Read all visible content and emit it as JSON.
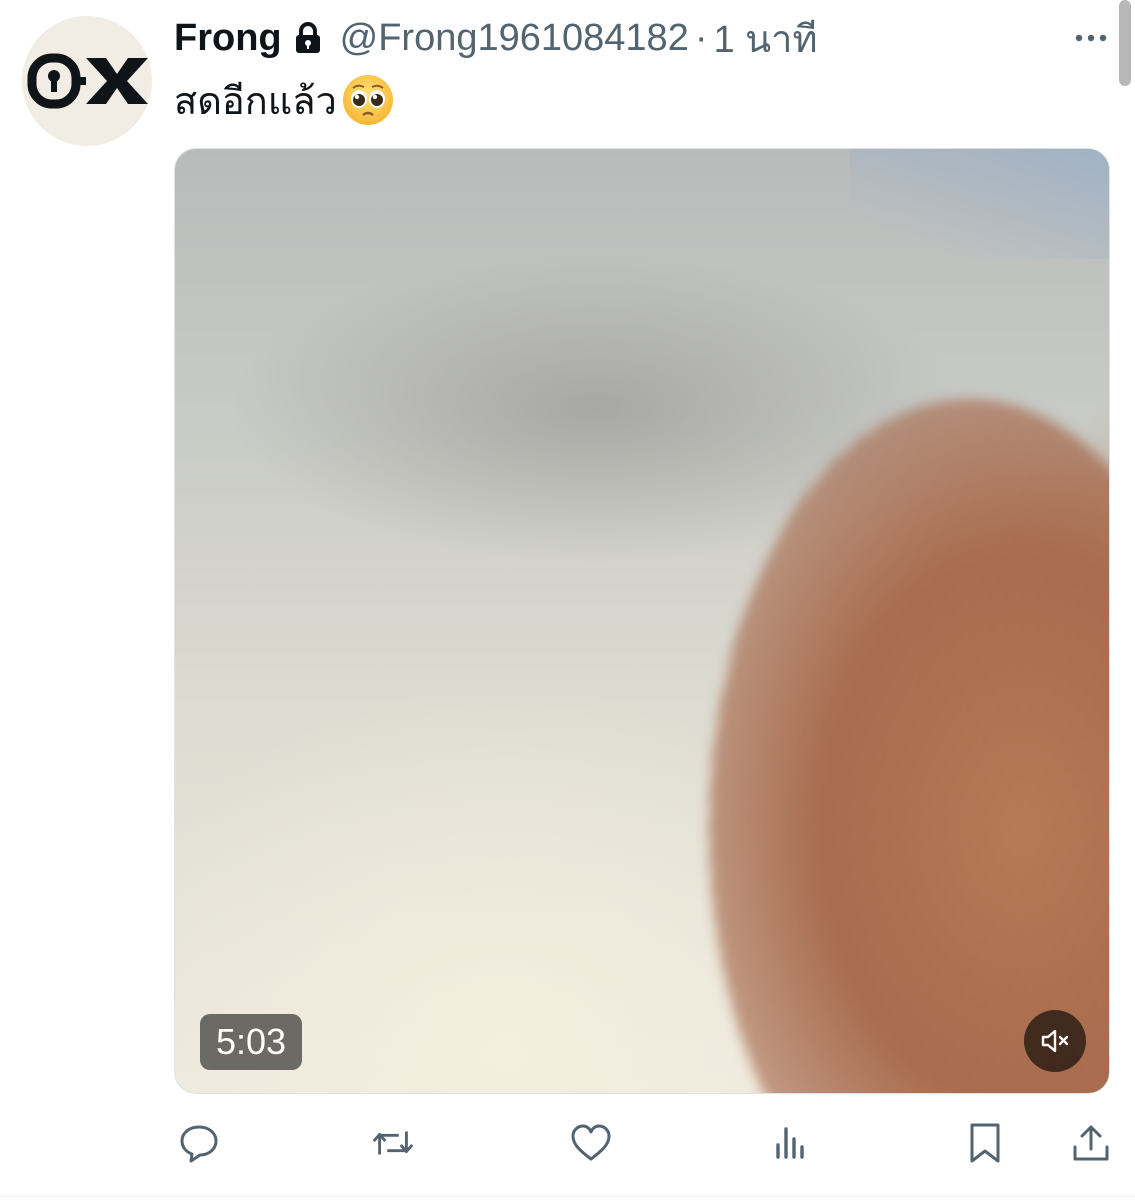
{
  "tweet": {
    "display_name": "Frong",
    "handle": "@Frong1961084182",
    "separator": "·",
    "timestamp": "1 นาที",
    "text": "สดอีกแล้ว",
    "emoji": "pleading-face-icon",
    "protected_icon": "lock-icon",
    "avatar_logo": "0X logo"
  },
  "media": {
    "type": "video",
    "duration": "5:03",
    "muted": true,
    "mute_icon": "speaker-muted-icon"
  },
  "actions": [
    {
      "name": "reply",
      "icon": "reply-icon"
    },
    {
      "name": "retweet",
      "icon": "retweet-icon"
    },
    {
      "name": "like",
      "icon": "heart-icon"
    },
    {
      "name": "views",
      "icon": "views-icon"
    },
    {
      "name": "bookmark",
      "icon": "bookmark-icon"
    },
    {
      "name": "share",
      "icon": "share-icon"
    }
  ],
  "colors": {
    "text_primary": "#0f1419",
    "text_secondary": "#536471",
    "icon": "#536471",
    "avatar_bg": "#f1ece4"
  }
}
